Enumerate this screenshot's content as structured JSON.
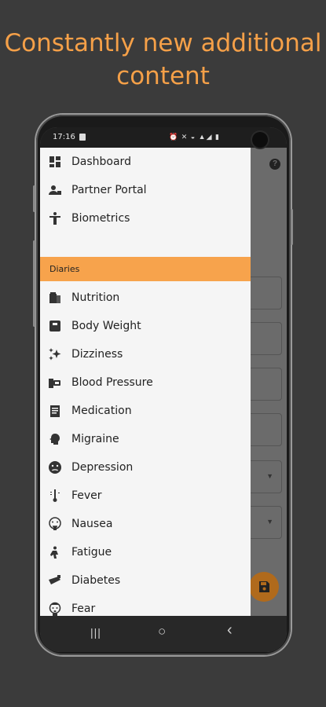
{
  "headline": {
    "line1": "Constantly new additional",
    "line2": "content"
  },
  "status_bar": {
    "time": "17:16",
    "icons": "⏰ ✕ ◒ ▲◢ ▮"
  },
  "background": {
    "help_icon": "?"
  },
  "drawer": {
    "top_items": [
      {
        "label": "Dashboard",
        "icon": "dashboard-icon"
      },
      {
        "label": "Partner Portal",
        "icon": "partner-icon"
      },
      {
        "label": "Biometrics",
        "icon": "person-icon"
      }
    ],
    "section_title": "Diaries",
    "diary_items": [
      {
        "label": "Nutrition",
        "icon": "nutrition-icon"
      },
      {
        "label": "Body Weight",
        "icon": "scale-icon"
      },
      {
        "label": "Dizziness",
        "icon": "sparkle-icon"
      },
      {
        "label": "Blood Pressure",
        "icon": "blood-pressure-icon"
      },
      {
        "label": "Medication",
        "icon": "clipboard-icon"
      },
      {
        "label": "Migraine",
        "icon": "head-icon"
      },
      {
        "label": "Depression",
        "icon": "sad-face-icon"
      },
      {
        "label": "Fever",
        "icon": "thermometer-icon"
      },
      {
        "label": "Nausea",
        "icon": "nausea-icon"
      },
      {
        "label": "Fatigue",
        "icon": "fatigue-icon"
      },
      {
        "label": "Diabetes",
        "icon": "glucose-meter-icon"
      },
      {
        "label": "Fear",
        "icon": "fear-face-icon"
      }
    ]
  },
  "nav_bar": {
    "recents": "|||",
    "home": "○",
    "back": "‹"
  },
  "colors": {
    "accent": "#f7a34c",
    "headline": "#f5a048",
    "background": "#3b3b3b"
  }
}
